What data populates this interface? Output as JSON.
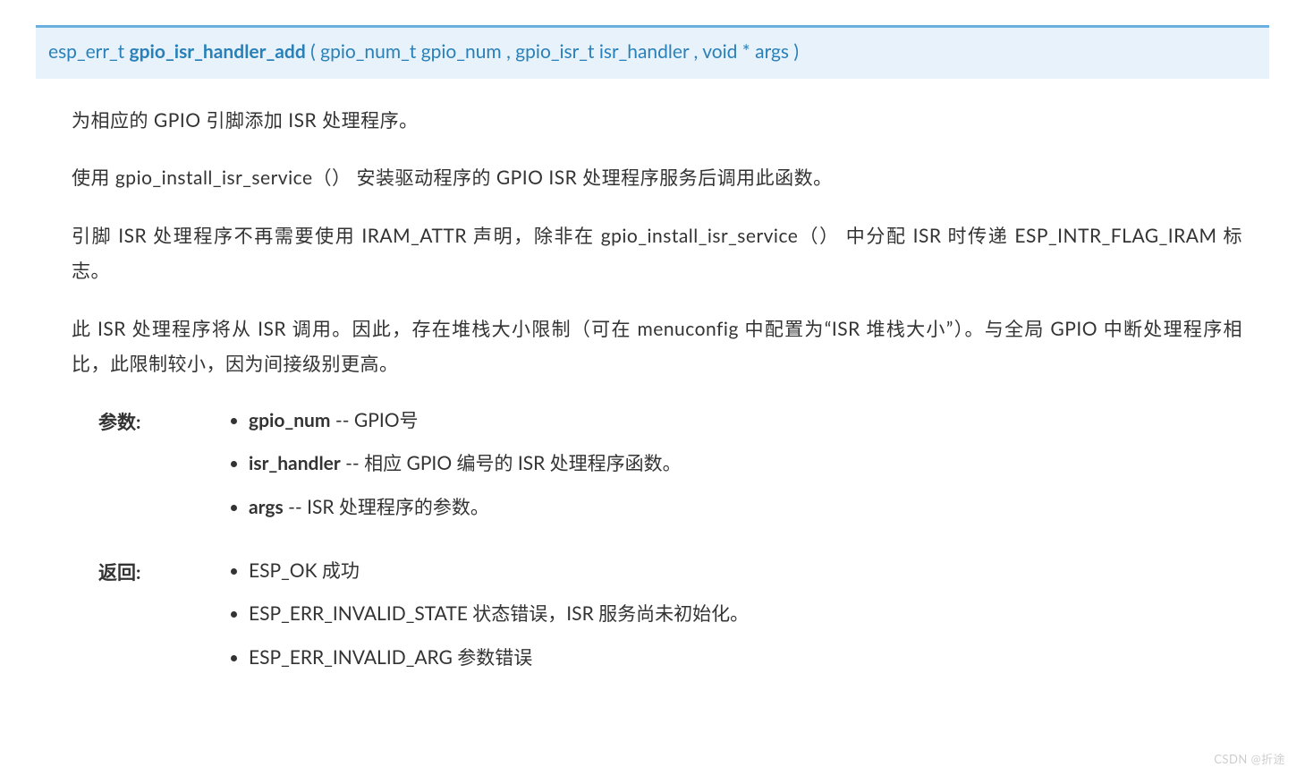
{
  "signature": {
    "return_type": "esp_err_t",
    "function_name": "gpio_isr_handler_add",
    "open": "(",
    "params": [
      {
        "type": "gpio_num_t",
        "name": "gpio_num"
      },
      {
        "type": "gpio_isr_t",
        "name": "isr_handler"
      },
      {
        "type": "void *",
        "name": "args"
      }
    ],
    "sep": ", ",
    "close": ")"
  },
  "description": {
    "p1": "为相应的 GPIO 引脚添加 ISR 处理程序。",
    "p2": "使用 gpio_install_isr_service（） 安装驱动程序的 GPIO ISR 处理程序服务后调用此函数。",
    "p3": "引脚 ISR 处理程序不再需要使用 IRAM_ATTR 声明，除非在 gpio_install_isr_service（） 中分配 ISR 时传递 ESP_INTR_FLAG_IRAM 标志。",
    "p4": "此 ISR 处理程序将从 ISR 调用。因此，存在堆栈大小限制（可在 menuconfig 中配置为“ISR 堆栈大小”）。与全局 GPIO 中断处理程序相比，此限制较小，因为间接级别更高。"
  },
  "params_section": {
    "label": "参数:",
    "items": [
      {
        "name": "gpio_num",
        "sep": " -- ",
        "desc": "GPIO号"
      },
      {
        "name": "isr_handler",
        "sep": " -- ",
        "desc": "相应 GPIO 编号的 ISR 处理程序函数。"
      },
      {
        "name": "args",
        "sep": " -- ",
        "desc": "ISR 处理程序的参数。"
      }
    ]
  },
  "returns_section": {
    "label": "返回:",
    "items": [
      "ESP_OK 成功",
      "ESP_ERR_INVALID_STATE 状态错误，ISR 服务尚未初始化。",
      "ESP_ERR_INVALID_ARG 参数错误"
    ]
  },
  "watermark": "CSDN @折途"
}
